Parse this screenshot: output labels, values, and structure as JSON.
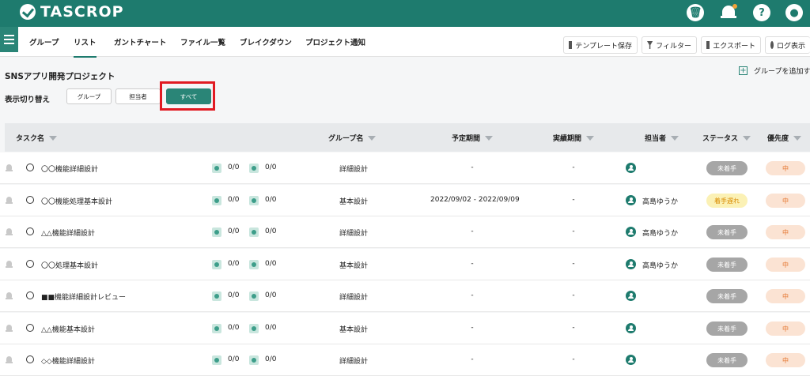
{
  "app": {
    "name": "TASCROP"
  },
  "tabs": [
    "グループ",
    "リスト",
    "ガントチャート",
    "ファイル一覧",
    "ブレイクダウン",
    "プロジェクト通知"
  ],
  "tools": [
    "テンプレート保存",
    "フィルター",
    "エクスポート",
    "ログ表示"
  ],
  "project": {
    "title": "SNSアプリ開発プロジェクト",
    "add_group": "グループを追加す"
  },
  "switcher": {
    "label": "表示切り替え",
    "options": [
      "グループ",
      "担当者",
      "すべて"
    ],
    "active": "すべて"
  },
  "columns": [
    "タスク名",
    "グループ名",
    "予定期間",
    "実績期間",
    "担当者",
    "ステータス",
    "優先度"
  ],
  "rows": [
    {
      "task": "〇〇機能詳細設計",
      "child": "0/0",
      "check": "0/0",
      "group": "詳細設計",
      "planned": "-",
      "actual": "-",
      "assignee": "",
      "status": "未着手",
      "priority": "中"
    },
    {
      "task": "〇〇機能処理基本設計",
      "child": "0/0",
      "check": "0/0",
      "group": "基本設計",
      "planned": "2022/09/02 - 2022/09/09",
      "actual": "-",
      "assignee": "高島ゆうか",
      "status": "着手遅れ",
      "priority": "中"
    },
    {
      "task": "△△機能詳細設計",
      "child": "0/0",
      "check": "0/0",
      "group": "詳細設計",
      "planned": "-",
      "actual": "-",
      "assignee": "高島ゆうか",
      "status": "未着手",
      "priority": "中"
    },
    {
      "task": "〇〇処理基本設計",
      "child": "0/0",
      "check": "0/0",
      "group": "基本設計",
      "planned": "-",
      "actual": "-",
      "assignee": "高島ゆうか",
      "status": "未着手",
      "priority": "中"
    },
    {
      "task": "■■機能詳細設計レビュー",
      "child": "0/0",
      "check": "0/0",
      "group": "詳細設計",
      "planned": "-",
      "actual": "-",
      "assignee": "",
      "status": "未着手",
      "priority": "中"
    },
    {
      "task": "△△機能基本設計",
      "child": "0/0",
      "check": "0/0",
      "group": "基本設計",
      "planned": "-",
      "actual": "-",
      "assignee": "",
      "status": "未着手",
      "priority": "中"
    },
    {
      "task": "◇◇機能詳細設計",
      "child": "0/0",
      "check": "0/0",
      "group": "詳細設計",
      "planned": "-",
      "actual": "-",
      "assignee": "",
      "status": "未着手",
      "priority": "中"
    }
  ],
  "colors": {
    "brand": "#1e7b6e",
    "highlight": "#e11b22",
    "status_gray": "#a6a6a6",
    "status_late": "#fbf1b5",
    "priority": "#fbe3d3"
  }
}
